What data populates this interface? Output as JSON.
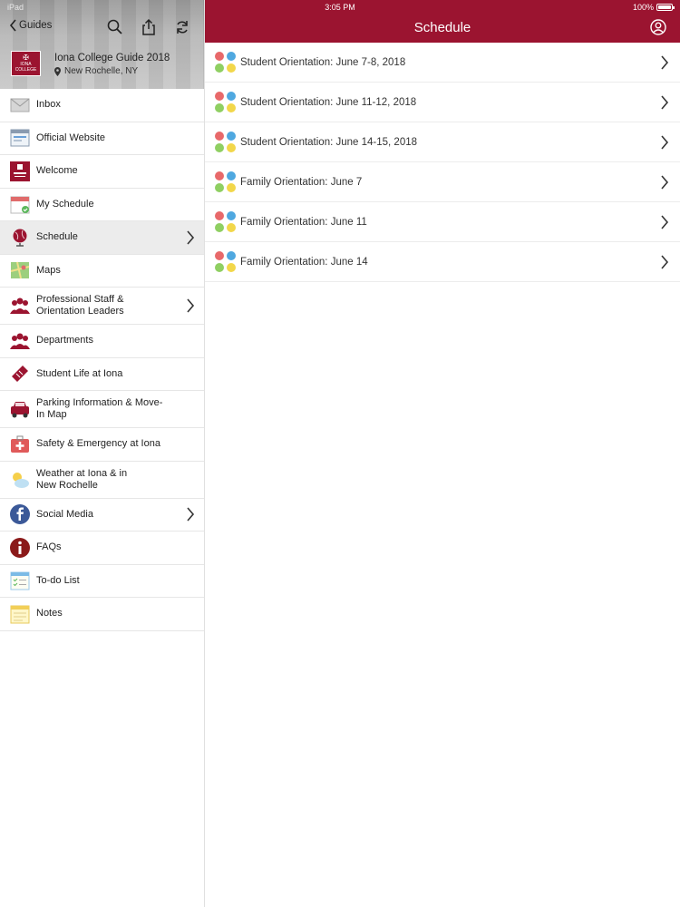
{
  "status": {
    "left": "iPad",
    "time": "3:05 PM",
    "battery": "100%"
  },
  "sidebar": {
    "back_label": "Guides",
    "guide": {
      "logo_text": "IONA",
      "logo_sub": "COLLEGE",
      "title": "Iona College Guide 2018",
      "location": "New Rochelle, NY"
    },
    "items": [
      {
        "label": "Inbox",
        "icon": "inbox-icon"
      },
      {
        "label": "Official Website",
        "icon": "website-icon"
      },
      {
        "label": "Welcome",
        "icon": "iona-logo-icon"
      },
      {
        "label": "My Schedule",
        "icon": "calendar-check-icon"
      },
      {
        "label": "Schedule",
        "icon": "globe-icon"
      },
      {
        "label": "Maps",
        "icon": "map-icon"
      },
      {
        "label_line1": "Professional Staff &",
        "label_line2": "Orientation Leaders",
        "icon": "people-icon"
      },
      {
        "label": "Departments",
        "icon": "people-icon"
      },
      {
        "label": "Student Life at Iona",
        "icon": "ticket-icon"
      },
      {
        "label_line1": "Parking Information & Move-",
        "label_line2": "In Map",
        "icon": "car-icon"
      },
      {
        "label": "Safety & Emergency at Iona",
        "icon": "first-aid-icon"
      },
      {
        "label_line1": "Weather at Iona & in",
        "label_line2": "New Rochelle",
        "icon": "weather-icon"
      },
      {
        "label": "Social Media",
        "icon": "facebook-icon"
      },
      {
        "label": "FAQs",
        "icon": "info-icon"
      },
      {
        "label": "To-do List",
        "icon": "checklist-icon"
      },
      {
        "label": "Notes",
        "icon": "notepad-icon"
      }
    ]
  },
  "main": {
    "title": "Schedule",
    "items": [
      {
        "label": "Student Orientation: June 7-8, 2018"
      },
      {
        "label": "Student Orientation: June 11-12, 2018"
      },
      {
        "label": "Student Orientation: June 14-15, 2018"
      },
      {
        "label": "Family Orientation: June 7"
      },
      {
        "label": "Family Orientation: June 11"
      },
      {
        "label": "Family Orientation: June 14"
      }
    ]
  },
  "colors": {
    "brand": "#9b1430",
    "active_row": "#ececec"
  }
}
